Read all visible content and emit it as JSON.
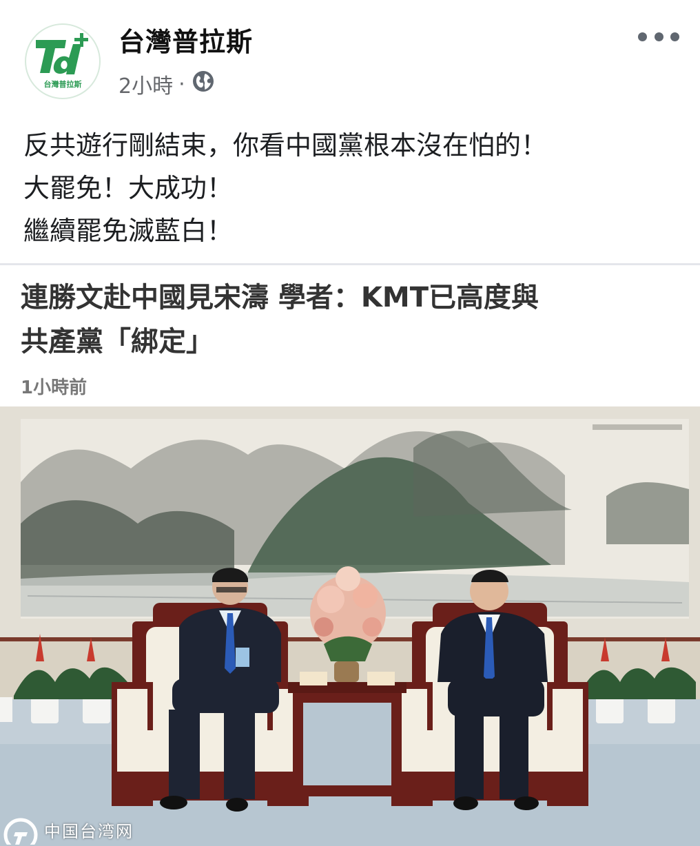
{
  "page": {
    "name": "台灣普拉斯",
    "avatar_caption": "台灣普拉斯",
    "time": "2小時",
    "separator": "·"
  },
  "post": {
    "lines": [
      "反共遊行剛結束，你看中國黨根本沒在怕的！",
      "大罷免！大成功！",
      "繼續罷免滅藍白！"
    ]
  },
  "link": {
    "title_line1": "連勝文赴中國見宋濤 學者：KMT已高度與",
    "title_line2": "共產黨「綁定」",
    "time": "1小時前"
  },
  "photo": {
    "watermark": "中国台湾网",
    "colors": {
      "wall": "#ddd9cf",
      "carpet": "#c3cfd8",
      "chair_wood": "#6a1f1a",
      "cushion": "#f3eee2",
      "suit": "#1e2433",
      "tie": "#2b5bb7",
      "flowers": "#c83a2e",
      "brand_green": "#2c9b54"
    }
  },
  "icons": [
    "globe-icon",
    "more-options-icon",
    "page-logo-icon"
  ]
}
